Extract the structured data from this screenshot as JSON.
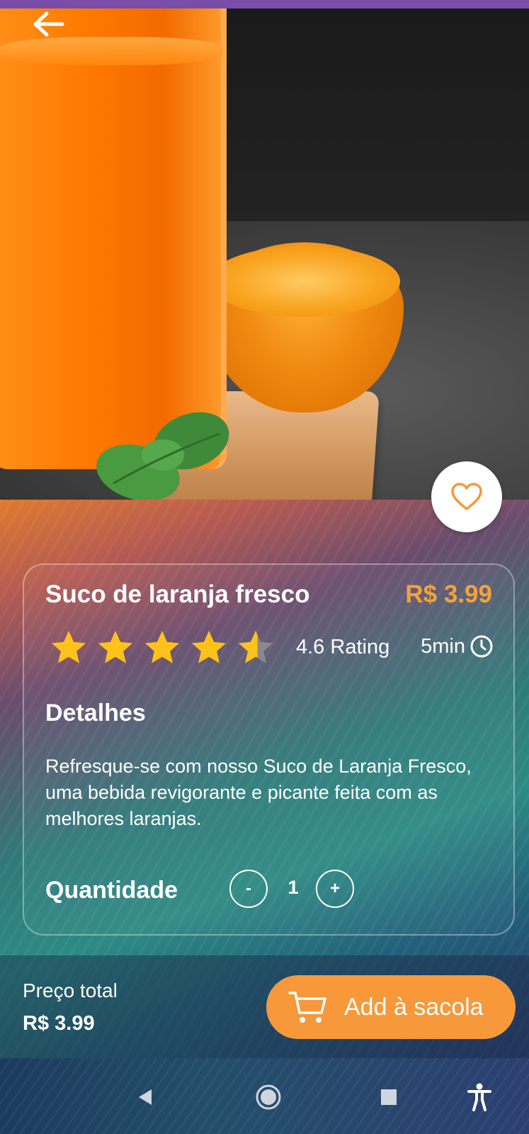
{
  "product": {
    "name": "Suco de laranja fresco",
    "price": "R$ 3.99",
    "rating_value": 4.6,
    "rating_text": "4.6 Rating",
    "time": "5min"
  },
  "details": {
    "title": "Detalhes",
    "description": "Refresque-se com nosso Suco de Laranja Fresco, uma bebida revigorante e picante feita com as melhores laranjas."
  },
  "quantity": {
    "label": "Quantidade",
    "minus": "-",
    "value": "1",
    "plus": "+"
  },
  "footer": {
    "total_label": "Preço total",
    "total_value": "R$ 3.99",
    "add_button": "Add à sacola"
  },
  "colors": {
    "accent": "#f7983a",
    "price": "#f7a13a",
    "star": "#ffc21a"
  },
  "icons": {
    "back": "arrow-left-icon",
    "favorite": "heart-outline-icon",
    "clock": "clock-icon",
    "cart": "cart-icon",
    "nav_back": "triangle-back-icon",
    "nav_home": "circle-home-icon",
    "nav_recents": "square-recents-icon",
    "nav_accessibility": "accessibility-icon"
  }
}
